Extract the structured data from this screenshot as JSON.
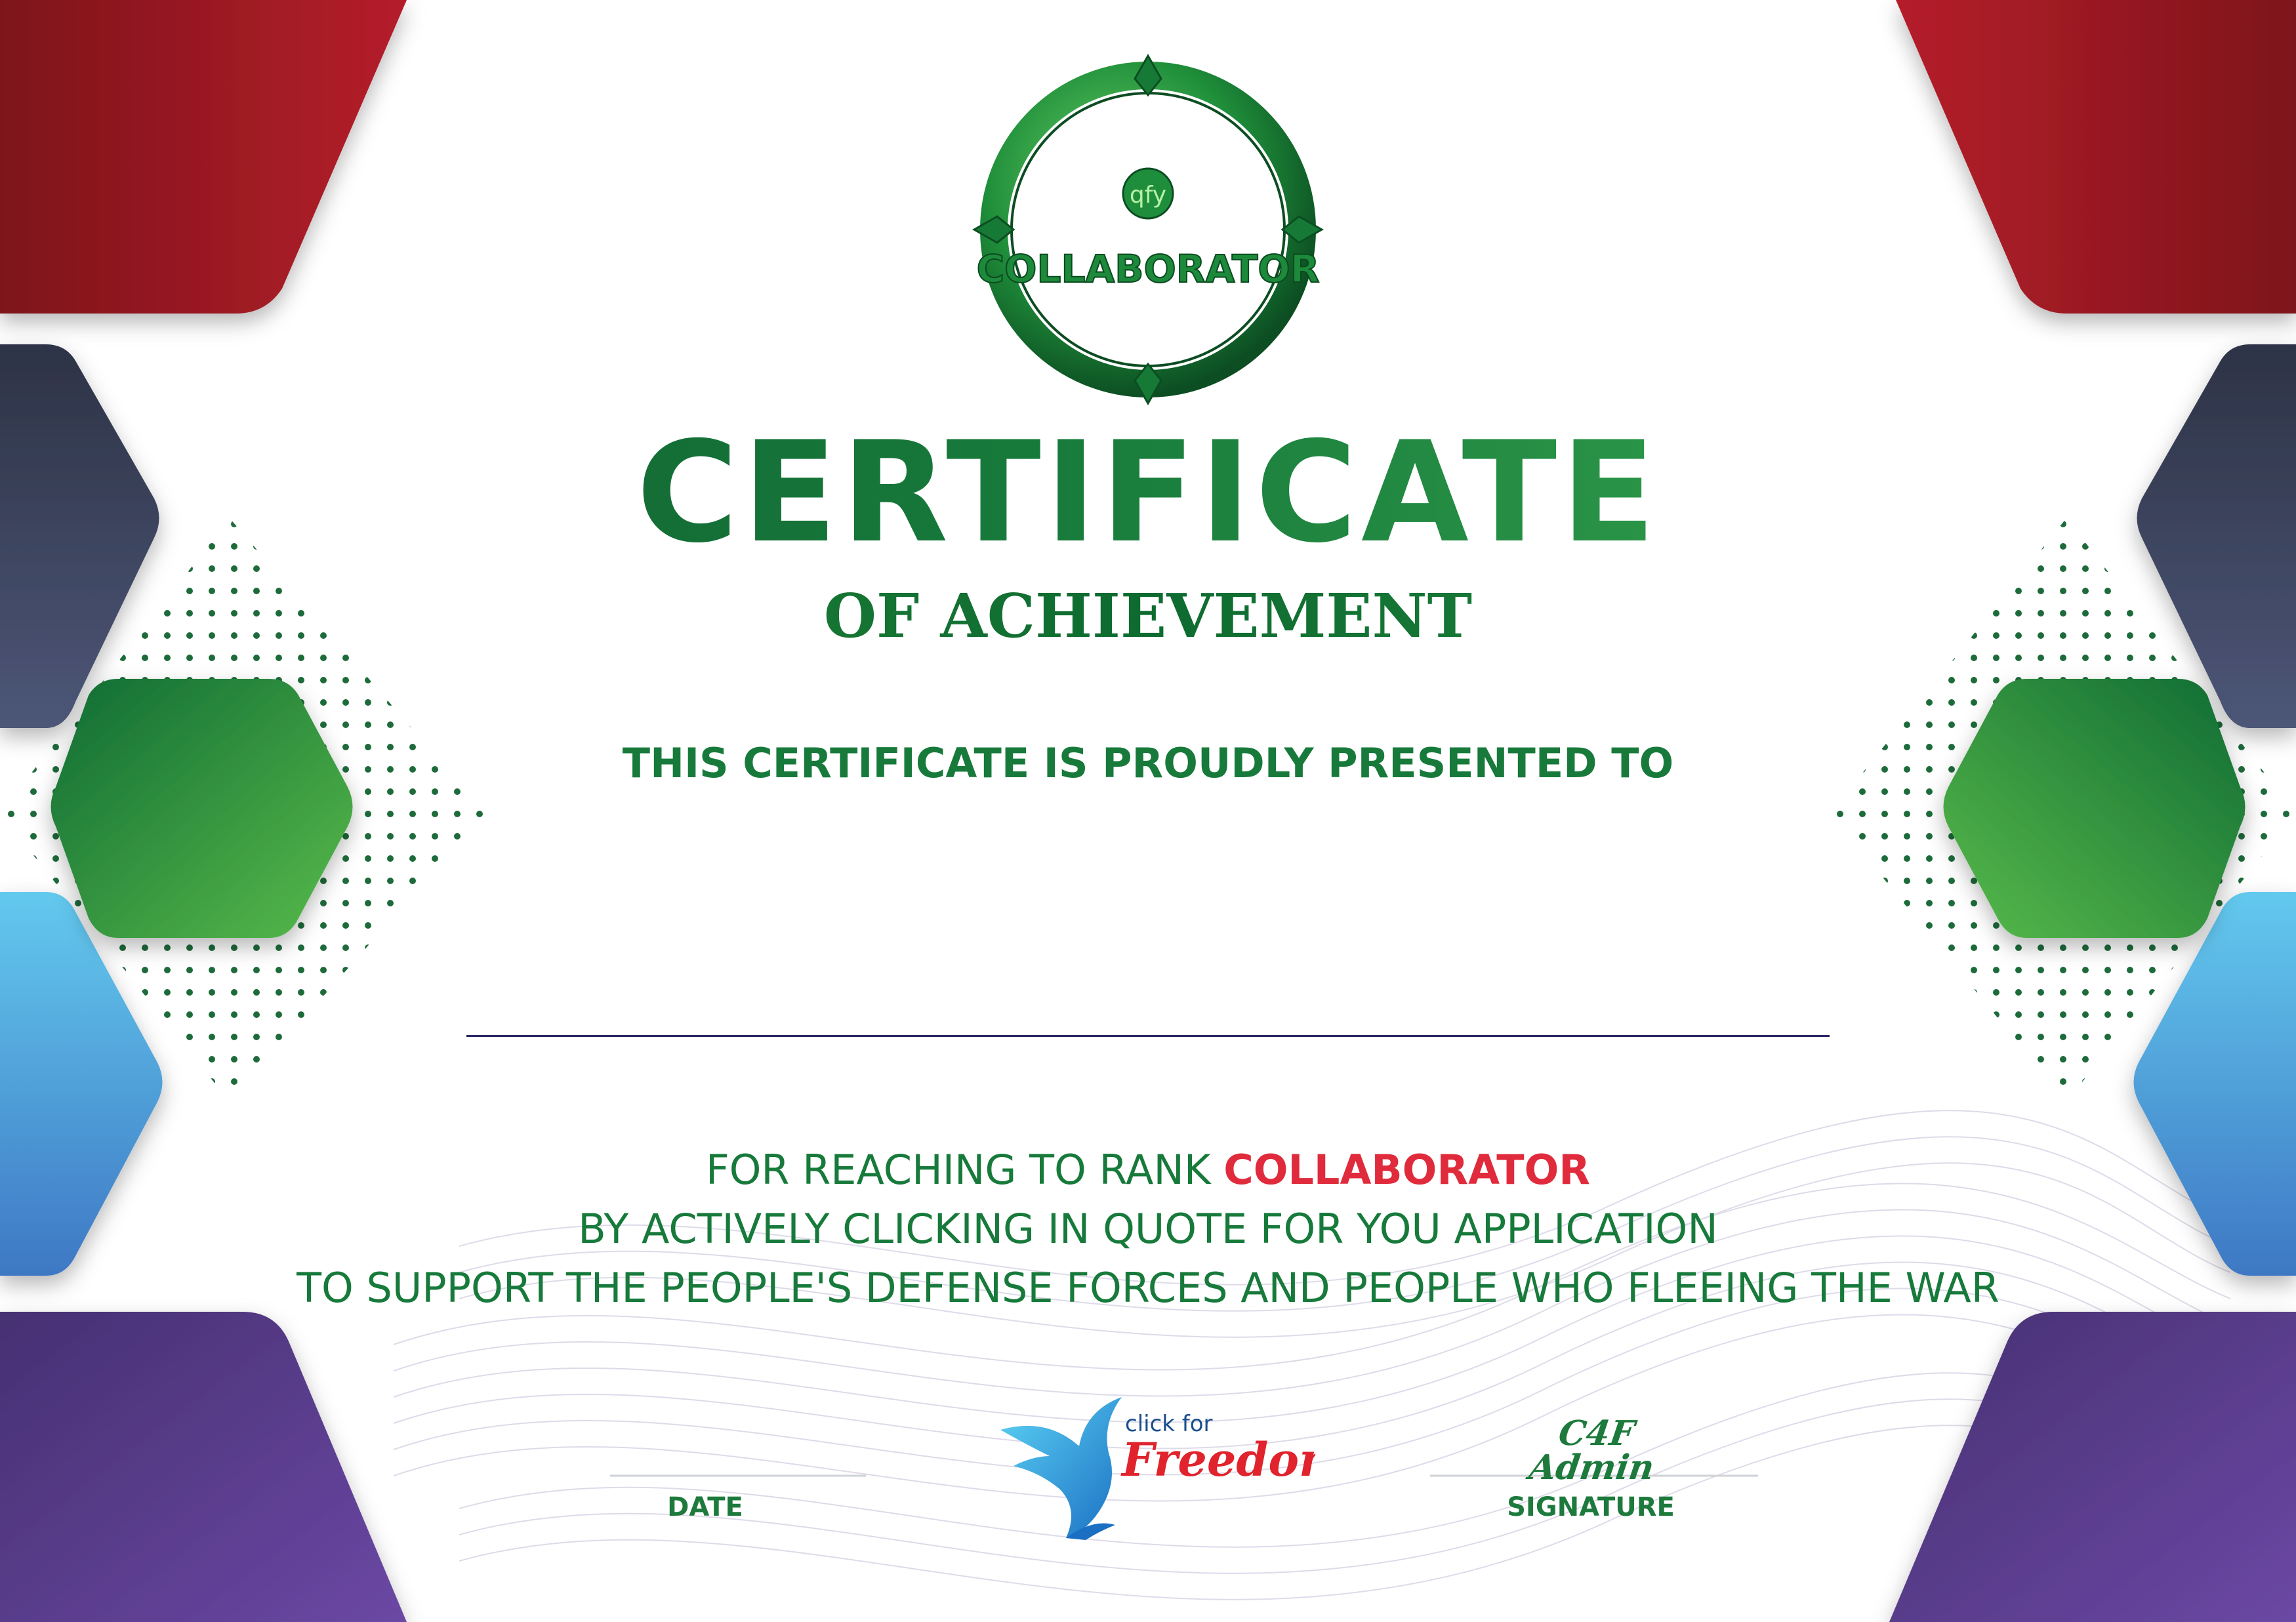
{
  "certificate": {
    "badge": {
      "monogram": "qfy",
      "rank_label": "COLLABORATOR"
    },
    "title": "CERTIFICATE",
    "subtitle": "OF ACHIEVEMENT",
    "presented_to": "THIS CERTIFICATE IS PROUDLY PRESENTED TO",
    "recipient_name": "",
    "body": {
      "line1_prefix": "FOR REACHING TO RANK ",
      "line1_rank": "COLLABORATOR",
      "line2": "BY ACTIVELY CLICKING IN QUOTE FOR YOU APPLICATION",
      "line3": "TO SUPPORT THE PEOPLE'S DEFENSE FORCES AND PEOPLE WHO FLEEING THE WAR"
    },
    "footer": {
      "date_label": "DATE",
      "signature_label": "SIGNATURE",
      "signature_text": "C4F Admin",
      "logo": {
        "small_text": "click for",
        "big_text": "Freedom"
      }
    }
  },
  "colors": {
    "green_dark": "#0e5a2e",
    "green": "#177a3b",
    "green_light": "#5cb848",
    "red": "#a51f28",
    "navy": "#3e4660",
    "sky": "#5cc3ea",
    "purple": "#5a3a8c",
    "rank_red": "#e02b3c",
    "logo_blue": "#1a8fd3",
    "logo_red": "#e0232c"
  },
  "icons": {
    "badge": "qfy-collaborator-badge",
    "logo": "click-for-freedom-dove-logo"
  }
}
